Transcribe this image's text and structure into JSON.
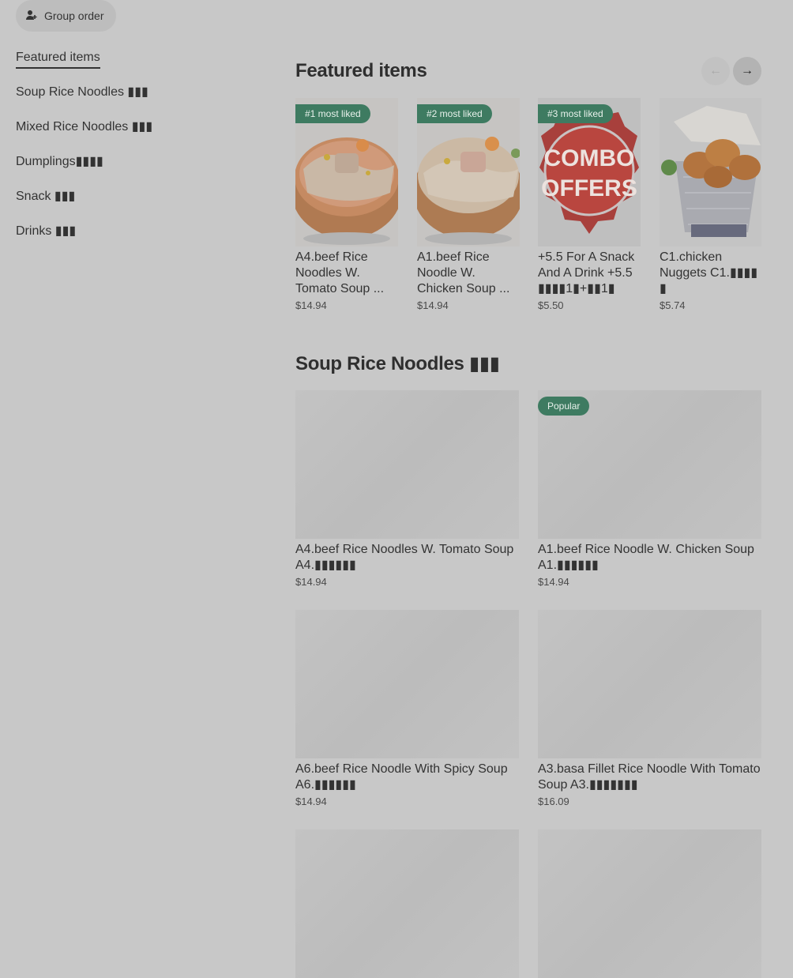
{
  "group_order": {
    "label": "Group order"
  },
  "sidebar": {
    "items": [
      {
        "label": "Featured items"
      },
      {
        "label": "Soup Rice Noodles ▮▮▮"
      },
      {
        "label": "Mixed Rice Noodles ▮▮▮"
      },
      {
        "label": "Dumplings▮▮▮▮"
      },
      {
        "label": "Snack ▮▮▮"
      },
      {
        "label": "Drinks ▮▮▮"
      }
    ]
  },
  "featured": {
    "title": "Featured items",
    "items": [
      {
        "badge": "#1 most liked",
        "name": "A4.beef Rice Noodles W. Tomato Soup ...",
        "price": "$14.94",
        "image": "tomato-soup-noodles"
      },
      {
        "badge": "#2 most liked",
        "name": "A1.beef Rice Noodle W. Chicken Soup ...",
        "price": "$14.94",
        "image": "chicken-soup-noodles"
      },
      {
        "badge": "#3 most liked",
        "name": "+5.5 For A Snack And A Drink +5.5 ▮▮▮▮1▮+▮▮1▮",
        "price": "$5.50",
        "image": "combo-offers",
        "image_text_1": "COMBO",
        "image_text_2": "OFFERS"
      },
      {
        "badge": "",
        "name": "C1.chicken Nuggets C1.▮▮▮▮ ▮",
        "price": "$5.74",
        "image": "chicken-nuggets"
      }
    ]
  },
  "soup_section": {
    "title": "Soup Rice Noodles ▮▮▮",
    "items": [
      {
        "badge": "",
        "name": "A4.beef Rice Noodles W. Tomato Soup A4.▮▮▮▮▮▮",
        "price": "$14.94"
      },
      {
        "badge": "Popular",
        "name": "A1.beef Rice Noodle W. Chicken Soup A1.▮▮▮▮▮▮",
        "price": "$14.94"
      },
      {
        "badge": "",
        "name": "A6.beef Rice Noodle With Spicy Soup A6.▮▮▮▮▮▮",
        "price": "$14.94"
      },
      {
        "badge": "",
        "name": "A3.basa Fillet Rice Noodle With Tomato Soup A3.▮▮▮▮▮▮▮",
        "price": "$16.09"
      },
      {
        "badge": "",
        "name": "",
        "price": ""
      },
      {
        "badge": "",
        "name": "",
        "price": ""
      }
    ]
  },
  "colors": {
    "background": "#c8c8c8",
    "badge": "#3e7b61",
    "text": "#2e2e2e"
  }
}
